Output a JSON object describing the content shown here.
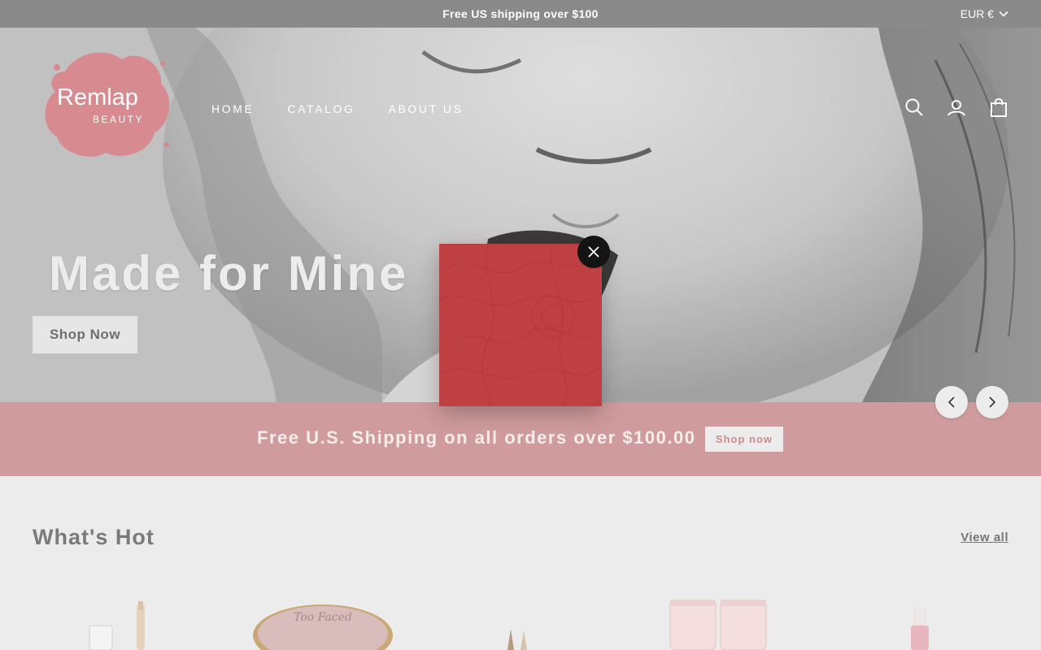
{
  "announcement": {
    "text": "Free US shipping over $100",
    "currency": "EUR €"
  },
  "header": {
    "logo_name": "Remlap",
    "logo_sub": "BEAUTY",
    "nav": [
      {
        "label": "HOME"
      },
      {
        "label": "CATALOG"
      },
      {
        "label": "ABOUT US"
      }
    ],
    "icons": [
      "search-icon",
      "account-icon",
      "cart-icon"
    ]
  },
  "hero": {
    "title": "Made for Mine",
    "button_label": "Shop Now"
  },
  "shipping_band": {
    "text": "Free U.S. Shipping on all orders over $100.00",
    "button_label": "Shop now"
  },
  "whats_hot": {
    "title": "What's Hot",
    "view_all_label": "View all"
  },
  "colors": {
    "announcement_bg": "#8a8a8a",
    "band_bg": "#cf9b9c",
    "popup_bg": "#bf4043",
    "section_bg": "#ececec"
  }
}
